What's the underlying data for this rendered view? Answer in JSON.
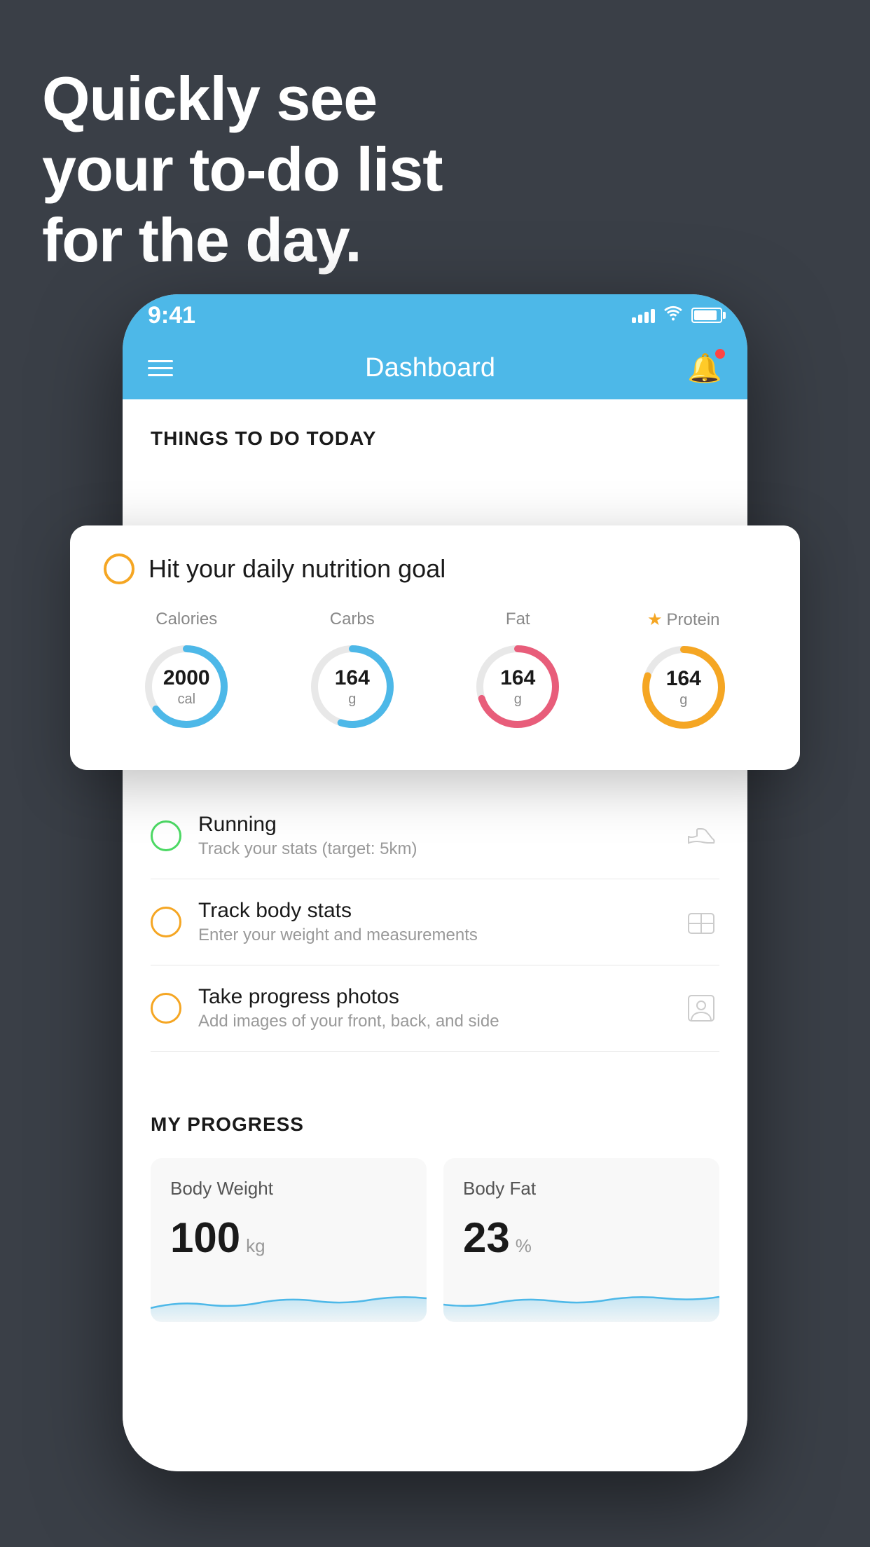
{
  "headline": {
    "line1": "Quickly see",
    "line2": "your to-do list",
    "line3": "for the day."
  },
  "statusBar": {
    "time": "9:41",
    "signalBars": [
      8,
      12,
      16,
      20
    ],
    "showWifi": true,
    "showBattery": true
  },
  "navBar": {
    "title": "Dashboard"
  },
  "sectionHeader": "THINGS TO DO TODAY",
  "floatingCard": {
    "indicator": "yellow",
    "title": "Hit your daily nutrition goal",
    "nutrition": [
      {
        "label": "Calories",
        "value": "2000",
        "unit": "cal",
        "color": "#4db8e8",
        "progress": 0.65,
        "star": false
      },
      {
        "label": "Carbs",
        "value": "164",
        "unit": "g",
        "color": "#4db8e8",
        "progress": 0.55,
        "star": false
      },
      {
        "label": "Fat",
        "value": "164",
        "unit": "g",
        "color": "#e85d7a",
        "progress": 0.7,
        "star": false
      },
      {
        "label": "Protein",
        "value": "164",
        "unit": "g",
        "color": "#f5a623",
        "progress": 0.8,
        "star": true
      }
    ]
  },
  "todoItems": [
    {
      "id": "running",
      "circleColor": "green",
      "title": "Running",
      "subtitle": "Track your stats (target: 5km)",
      "icon": "👟"
    },
    {
      "id": "body-stats",
      "circleColor": "yellow",
      "title": "Track body stats",
      "subtitle": "Enter your weight and measurements",
      "icon": "⚖"
    },
    {
      "id": "photos",
      "circleColor": "yellow",
      "title": "Take progress photos",
      "subtitle": "Add images of your front, back, and side",
      "icon": "🖼"
    }
  ],
  "progressSection": {
    "header": "MY PROGRESS",
    "cards": [
      {
        "title": "Body Weight",
        "value": "100",
        "unit": "kg"
      },
      {
        "title": "Body Fat",
        "value": "23",
        "unit": "%"
      }
    ]
  },
  "colors": {
    "background": "#3a3f47",
    "appBlue": "#4db8e8",
    "yellow": "#f5a623",
    "green": "#4cd964",
    "pink": "#e85d7a"
  }
}
